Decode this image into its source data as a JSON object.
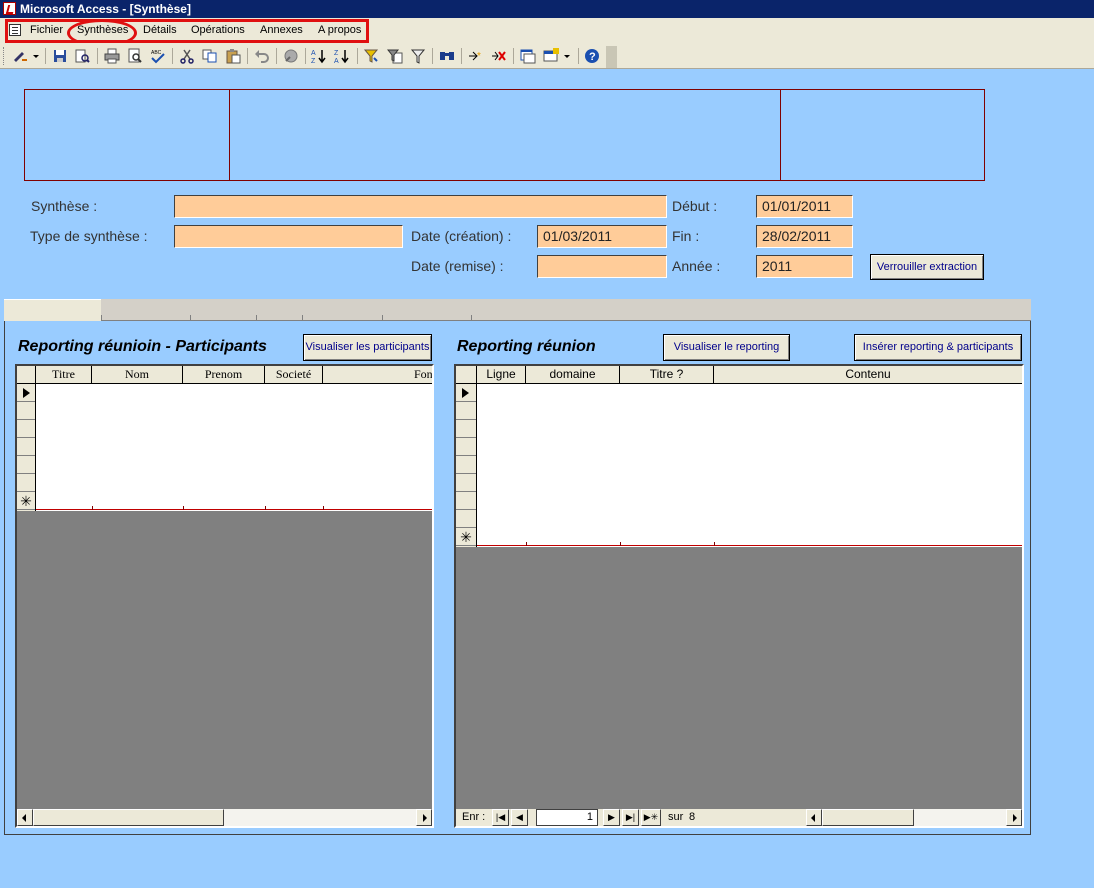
{
  "window": {
    "title": "Microsoft Access - [Synthèse]"
  },
  "menu": {
    "items": [
      "Fichier",
      "Synthèses",
      "Détails",
      "Opérations",
      "Annexes",
      "A propos"
    ]
  },
  "toolbar": {
    "icons": [
      "design-view-icon",
      "save-icon",
      "search-files-icon",
      "print-icon",
      "print-preview-icon",
      "spelling-icon",
      "cut-icon",
      "copy-icon",
      "paste-icon",
      "undo-icon",
      "hyperlink-icon",
      "sort-ascending-icon",
      "sort-descending-icon",
      "filter-by-selection-icon",
      "filter-by-form-icon",
      "apply-filter-icon",
      "find-icon",
      "new-record-icon",
      "delete-record-icon",
      "database-window-icon",
      "new-object-icon",
      "help-icon"
    ]
  },
  "form": {
    "synthese_label": "Synthèse :",
    "synthese_value": "",
    "type_label": "Type de synthèse :",
    "type_value": "",
    "debut_label": "Début :",
    "debut_value": "01/01/2011",
    "date_creation_label": "Date (création) :",
    "date_creation_value": "01/03/2011",
    "fin_label": "Fin :",
    "fin_value": "28/02/2011",
    "date_remise_label": "Date (remise) :",
    "date_remise_value": "",
    "annee_label": "Année :",
    "annee_value": "2011",
    "lock_button": "Verrouiller extraction"
  },
  "left_panel": {
    "title": "Reporting réunioin - Participants",
    "button": "Visualiser les participants",
    "columns": [
      "Titre",
      "Nom",
      "Prenom",
      "Societé",
      "Fonc"
    ]
  },
  "right_panel": {
    "title": "Reporting réunion",
    "button_view": "Visualiser le reporting",
    "button_insert": "Insérer reporting & participants",
    "columns": [
      "Ligne",
      "domaine",
      "Titre ?",
      "Contenu"
    ],
    "nav": {
      "label": "Enr :",
      "current": "1",
      "of_label": "sur",
      "total": "8"
    }
  },
  "colors": {
    "background": "#99ccff",
    "field": "#ffcc99",
    "border": "#800000",
    "grid_empty": "#808080"
  }
}
